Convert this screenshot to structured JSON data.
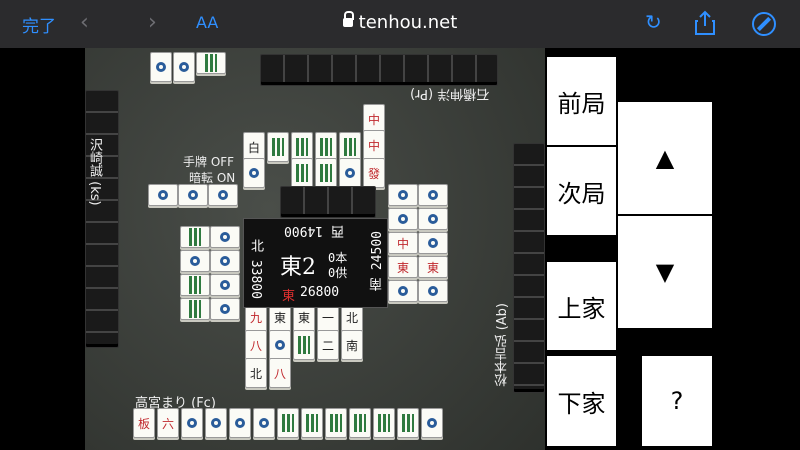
{
  "browser": {
    "done": "完了",
    "aa": "AA",
    "url": "tenhou.net",
    "accent": "#2f8fff"
  },
  "players": {
    "top": "石橋伸洋 (Pr)",
    "left": "沢崎誠 (ks)",
    "right": "松本吉弘 (Ab)",
    "bottom": "高宮まり (Fc)"
  },
  "options": {
    "hand": "手牌 OFF",
    "ankan": "暗転 ON"
  },
  "center": {
    "round": "東2",
    "honba": "0本",
    "kyotaku": "0供",
    "scores": {
      "top": "西 14900",
      "left": "北 33800",
      "right": "南 24500",
      "bottom_wind": "東",
      "bottom": "26800"
    }
  },
  "controls": {
    "prev_round": "前局",
    "next_round": "次局",
    "up": "▲",
    "down": "▼",
    "kamicha": "上家",
    "shimocha": "下家",
    "help": "?"
  },
  "tiles": {
    "bottom_hand": [
      "板",
      "六",
      "⊙",
      "⊙",
      "⊙",
      "|",
      "|",
      "|",
      "|",
      "|",
      "⊙",
      "⊙",
      "⊙"
    ],
    "discards_bottom": [
      "九",
      "東",
      "東",
      "一",
      "北",
      "八",
      "⊙",
      "|",
      "二",
      "南",
      "北",
      "八"
    ]
  }
}
